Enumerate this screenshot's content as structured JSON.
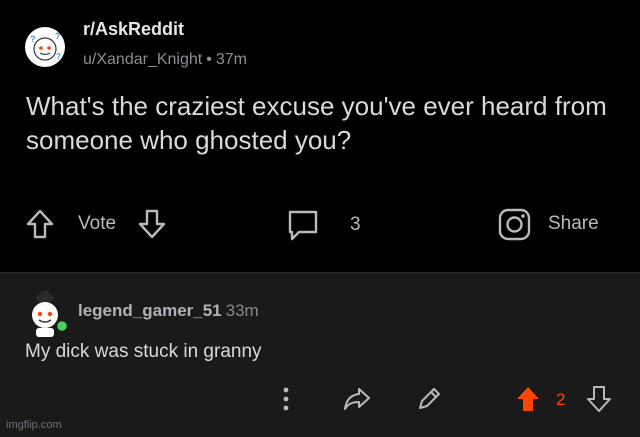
{
  "post": {
    "subreddit": "r/AskReddit",
    "author": "u/Xandar_Knight",
    "separator": "•",
    "time": "37m",
    "title": "What's the craziest excuse you've ever heard from someone who ghosted you?",
    "vote_label": "Vote",
    "comment_count": "3",
    "share_label": "Share"
  },
  "comment": {
    "username": "legend_gamer_51",
    "time": "33m",
    "body": "My dick was stuck in granny",
    "score": "2"
  },
  "watermark": "imgflip.com",
  "colors": {
    "background": "#000000",
    "comment_background": "#1a1a1b",
    "upvote_active": "#ff4500",
    "online_dot": "#46d160"
  },
  "icons": [
    "subreddit-avatar-icon",
    "upvote-arrow-icon",
    "downvote-arrow-icon",
    "comment-bubble-icon",
    "share-icon",
    "more-options-icon",
    "reply-share-icon",
    "edit-pencil-icon"
  ]
}
